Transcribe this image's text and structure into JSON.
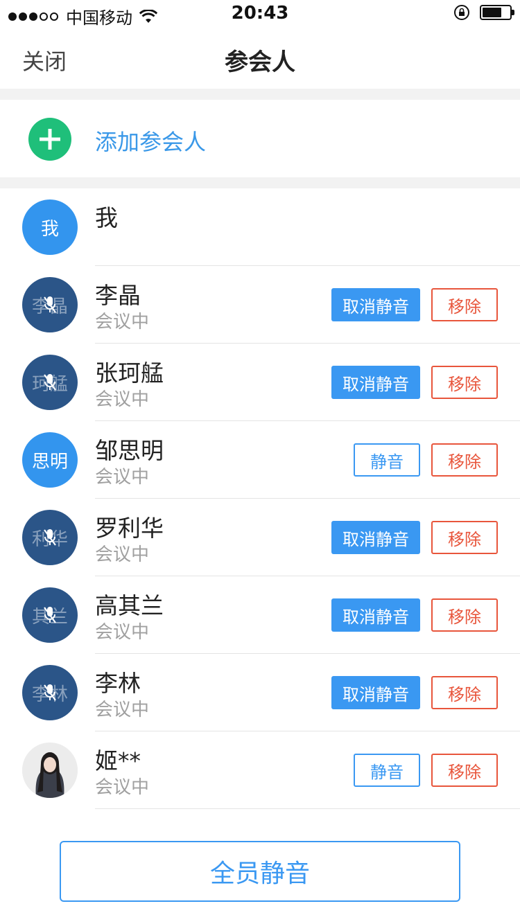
{
  "status_bar": {
    "carrier": "中国移动",
    "time": "20:43",
    "signal_filled": 3,
    "signal_total": 5,
    "battery_level": 0.72
  },
  "nav": {
    "close_label": "关闭",
    "title": "参会人"
  },
  "add_participant": {
    "label": "添加参会人",
    "icon": "plus-circle-icon"
  },
  "participants": [
    {
      "name": "我",
      "avatar_text": "我",
      "avatar_style": "blue",
      "status": "",
      "muted": false,
      "actions": []
    },
    {
      "name": "李晶",
      "avatar_text": "李晶",
      "avatar_style": "navy",
      "status": "会议中",
      "muted": true,
      "mute_button": "取消静音",
      "remove_button": "移除"
    },
    {
      "name": "张珂艋",
      "avatar_text": "珂艋",
      "avatar_style": "navy",
      "status": "会议中",
      "muted": true,
      "mute_button": "取消静音",
      "remove_button": "移除"
    },
    {
      "name": "邹思明",
      "avatar_text": "思明",
      "avatar_style": "blue",
      "status": "会议中",
      "muted": false,
      "mute_button": "静音",
      "remove_button": "移除"
    },
    {
      "name": "罗利华",
      "avatar_text": "利华",
      "avatar_style": "navy",
      "status": "会议中",
      "muted": true,
      "mute_button": "取消静音",
      "remove_button": "移除"
    },
    {
      "name": "高其兰",
      "avatar_text": "其兰",
      "avatar_style": "navy",
      "status": "会议中",
      "muted": true,
      "mute_button": "取消静音",
      "remove_button": "移除"
    },
    {
      "name": "李林",
      "avatar_text": "李林",
      "avatar_style": "navy",
      "status": "会议中",
      "muted": true,
      "mute_button": "取消静音",
      "remove_button": "移除"
    },
    {
      "name": "姬**",
      "avatar_text": "",
      "avatar_style": "photo",
      "status": "会议中",
      "muted": false,
      "mute_button": "静音",
      "remove_button": "移除"
    }
  ],
  "mute_all_label": "全员静音",
  "colors": {
    "primary_blue": "#3a98f2",
    "navy_avatar": "#2b5588",
    "avatar_blue": "#3395ee",
    "add_green": "#1fbf7a",
    "remove_red": "#e8553b",
    "status_gray": "#a0a0a0",
    "section_gap": "#f2f2f2"
  }
}
